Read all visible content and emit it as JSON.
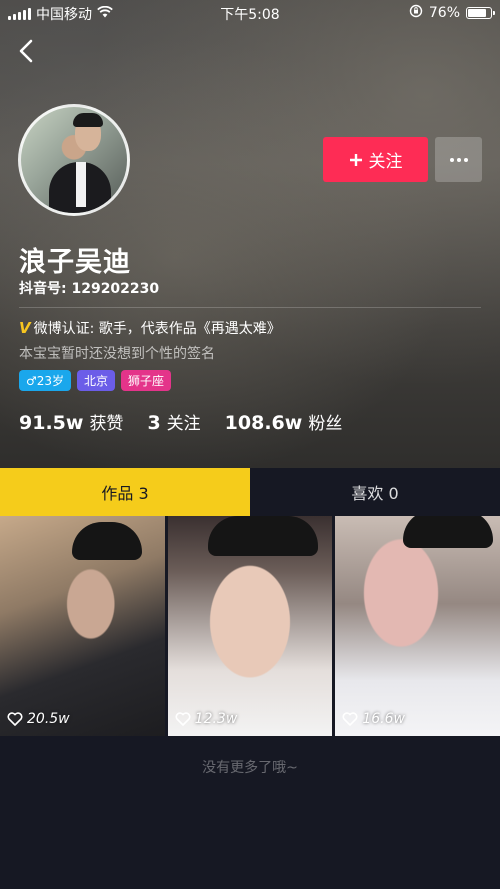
{
  "status_bar": {
    "carrier": "中国移动",
    "time": "下午5:08",
    "battery_text": "76%",
    "battery_level": 0.76
  },
  "profile": {
    "nickname": "浪子吴迪",
    "douyin_id": "抖音号: 129202230",
    "verification": "微博认证: 歌手，代表作品《再遇太难》",
    "verification_badge": "V",
    "signature": "本宝宝暂时还没想到个性的签名",
    "tags": {
      "age": "♂23岁",
      "city": "北京",
      "zodiac": "狮子座"
    }
  },
  "actions": {
    "follow_label": "关注"
  },
  "stats": {
    "likes_value": "91.5w",
    "likes_label": "获赞",
    "following_value": "3",
    "following_label": "关注",
    "fans_value": "108.6w",
    "fans_label": "粉丝"
  },
  "tabs": [
    {
      "label": "作品 3",
      "active": true
    },
    {
      "label": "喜欢 0",
      "active": false
    }
  ],
  "videos": [
    {
      "likes": "20.5w"
    },
    {
      "likes": "12.3w"
    },
    {
      "likes": "16.6w"
    }
  ],
  "footer": {
    "no_more_text": "没有更多了哦~"
  },
  "colors": {
    "follow_button": "#fe2c55",
    "tab_active": "#f5cc1b",
    "background": "#161823",
    "tag_age": "#1aa7ec",
    "tag_city": "#6b5de8",
    "tag_zodiac": "#e4348a",
    "verify_badge": "#f7c520"
  },
  "icons": [
    "signal-icon",
    "wifi-icon",
    "orientation-lock-icon",
    "battery-icon",
    "back-arrow-icon",
    "plus-icon",
    "more-dots-icon",
    "heart-icon"
  ]
}
